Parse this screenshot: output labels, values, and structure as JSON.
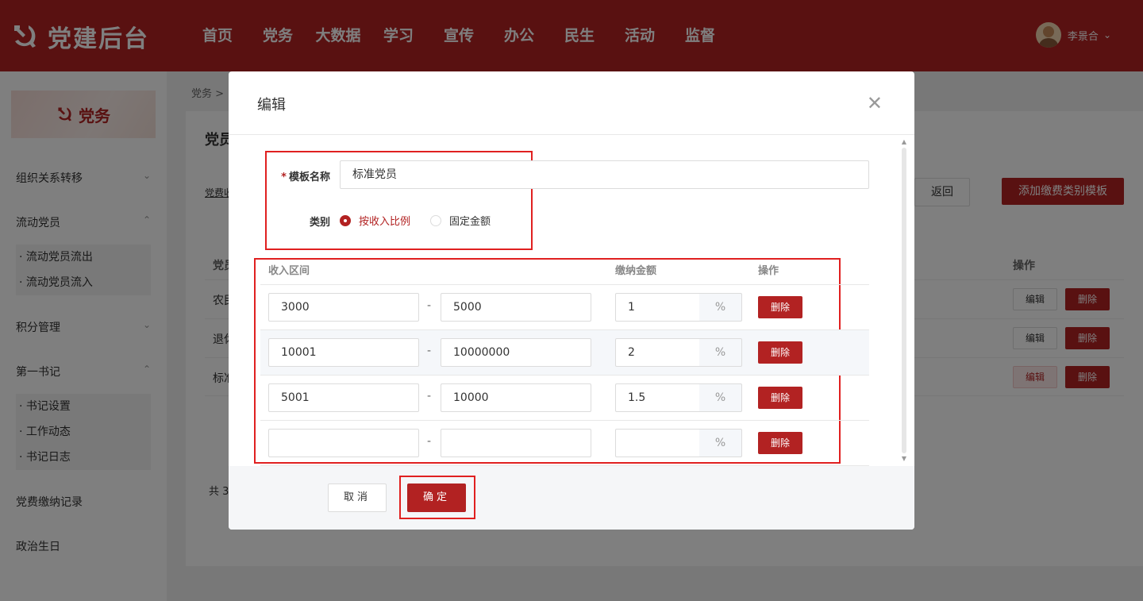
{
  "header": {
    "logo_text": "党建后台",
    "nav": [
      "首页",
      "党务",
      "大数据",
      "学习",
      "宣传",
      "办公",
      "民生",
      "活动",
      "监督"
    ],
    "user_name": "李景合"
  },
  "sidebar": {
    "banner": "党务",
    "menu": {
      "org_transfer": "组织关系转移",
      "floating": "流动党员",
      "floating_out": "· 流动党员流出",
      "floating_in": "· 流动党员流入",
      "points": "积分管理",
      "secretary": "第一书记",
      "sec_settings": "· 书记设置",
      "sec_news": "· 工作动态",
      "sec_log": "· 书记日志",
      "fee_records": "党费缴纳记录",
      "political_birthday": "政治生日"
    }
  },
  "content": {
    "breadcrumb": "党务 >",
    "panel_title": "党员",
    "panel_link": "党费收",
    "back_button": "返回",
    "add_button": "添加缴费类别模板",
    "col_name": "党员",
    "col_action": "操作",
    "rows": [
      "农民",
      "退休",
      "标准"
    ],
    "edit_label": "编辑",
    "delete_label": "删除",
    "total": "共 3"
  },
  "modal": {
    "title": "编辑",
    "name_label": "模板名称",
    "required_mark": "*",
    "name_value": "标准党员",
    "category_label": "类别",
    "category_options": [
      "按收入比例",
      "固定金额"
    ],
    "category_selected": "按收入比例",
    "col_income": "收入区间",
    "col_amount": "缴纳金额",
    "col_action": "操作",
    "rows": [
      {
        "min": "3000",
        "max": "5000",
        "amount": "1"
      },
      {
        "min": "10001",
        "max": "10000000",
        "amount": "2"
      },
      {
        "min": "5001",
        "max": "10000",
        "amount": "1.5"
      },
      {
        "min": "",
        "max": "",
        "amount": ""
      }
    ],
    "dash": "-",
    "percent": "%",
    "delete_label": "删除",
    "cancel": "取消",
    "confirm": "确定"
  }
}
